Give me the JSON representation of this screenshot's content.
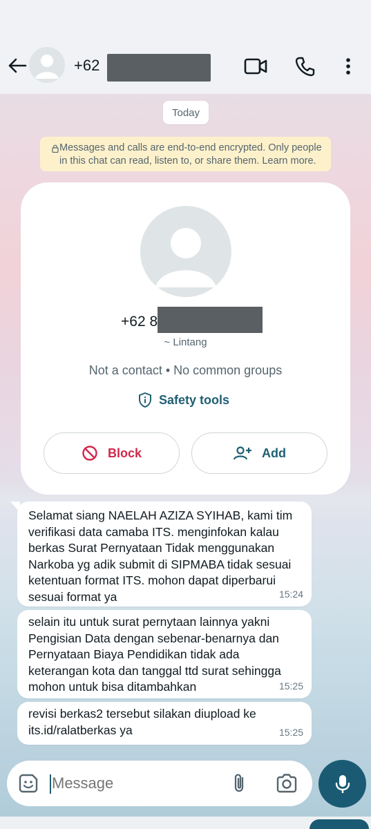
{
  "header": {
    "title_prefix": "+62",
    "icons": [
      "back-arrow-icon",
      "avatar",
      "video-call-icon",
      "voice-call-icon",
      "more-options-icon"
    ]
  },
  "chat": {
    "date_chip": "Today",
    "encryption_notice": "Messages and calls are end-to-end encrypted. Only people in this chat can read, listen to, or share them. Learn more.",
    "contact_card": {
      "phone_prefix": "+62 8",
      "name": "~ Lintang",
      "subtitle": "Not a contact • No common groups",
      "safety_tools_label": "Safety tools",
      "block_label": "Block",
      "add_label": "Add"
    },
    "messages": [
      {
        "text": "Selamat siang NAELAH AZIZA SYIHAB, kami tim verifikasi data camaba ITS. menginfokan kalau berkas Surat Pernyataan Tidak menggunakan Narkoba yg adik submit di SIPMABA tidak sesuai ketentuan format ITS. mohon dapat diperbarui sesuai format ya",
        "time": "15:24"
      },
      {
        "text": "selain itu untuk surat pernytaan lainnya yakni Pengisian Data dengan sebenar-benarnya dan Pernyataan Biaya Pendidikan tidak ada keterangan kota dan tanggal ttd surat sehingga mohon untuk bisa ditambahkan",
        "time": "15:25"
      },
      {
        "text": "revisi berkas2 tersebut silakan diupload ke its.id/ralatberkas ya",
        "time": "15:25"
      }
    ]
  },
  "composer": {
    "placeholder": "Message"
  },
  "colors": {
    "accent": "#1a5b73",
    "block_red": "#d0284b",
    "banner_yellow": "#fdf1cb"
  }
}
